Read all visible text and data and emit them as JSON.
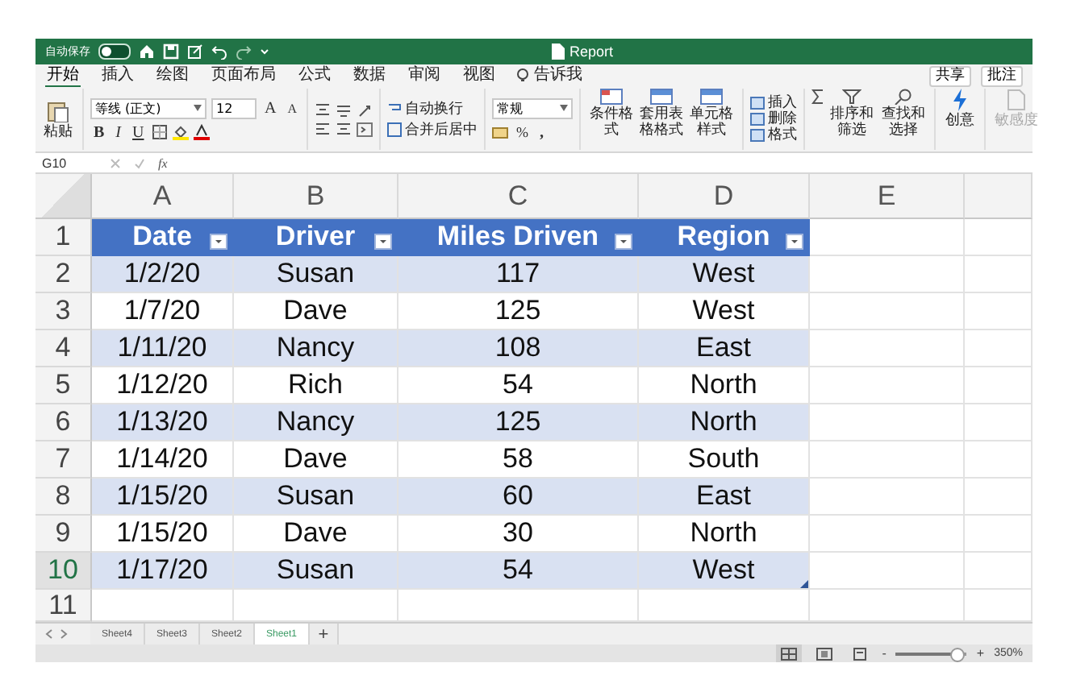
{
  "title_bar": {
    "autosave_label": "自动保存",
    "autosave_on": false,
    "title": "Report"
  },
  "menu": {
    "tabs": [
      {
        "label": "开始",
        "selected": true
      },
      {
        "label": "插入",
        "selected": false
      },
      {
        "label": "绘图",
        "selected": false
      },
      {
        "label": "页面布局",
        "selected": false
      },
      {
        "label": "公式",
        "selected": false
      },
      {
        "label": "数据",
        "selected": false
      },
      {
        "label": "审阅",
        "selected": false
      },
      {
        "label": "视图",
        "selected": false
      }
    ],
    "tell_me": "告诉我",
    "share": "共享",
    "comments": "批注"
  },
  "ribbon": {
    "paste": "粘贴",
    "font_name": "等线 (正文)",
    "font_size": "12",
    "font_grow": "A",
    "font_shrink": "A",
    "format_buttons": [
      "B",
      "I",
      "U"
    ],
    "wrap_text": "自动换行",
    "merge_center": "合并后居中",
    "number_format": "常规",
    "percent": "%",
    "comma": ",",
    "style_buttons": [
      "条件格式",
      "套用表格格式",
      "单元格样式"
    ],
    "cell_buttons": [
      "插入",
      "删除",
      "格式"
    ],
    "edit_buttons": [
      "排序和筛选",
      "查找和选择"
    ],
    "ideas": "创意",
    "sensitivity": {
      "label": "敏感度",
      "disabled": true
    }
  },
  "formula_bar": {
    "cell_ref": "G10",
    "fx": "fx"
  },
  "sheet": {
    "columns": [
      "A",
      "B",
      "C",
      "D",
      "E"
    ],
    "rows": [
      {
        "number": "1",
        "active": false,
        "kind": "header",
        "cells": [
          "Date",
          "Driver",
          "Miles Driven",
          "Region"
        ]
      },
      {
        "number": "2",
        "active": false,
        "kind": "data",
        "banded": true,
        "cells": [
          "1/2/20",
          "Susan",
          "117",
          "West"
        ]
      },
      {
        "number": "3",
        "active": false,
        "kind": "data",
        "banded": false,
        "cells": [
          "1/7/20",
          "Dave",
          "125",
          "West"
        ]
      },
      {
        "number": "4",
        "active": false,
        "kind": "data",
        "banded": true,
        "cells": [
          "1/11/20",
          "Nancy",
          "108",
          "East"
        ]
      },
      {
        "number": "5",
        "active": false,
        "kind": "data",
        "banded": false,
        "cells": [
          "1/12/20",
          "Rich",
          "54",
          "North"
        ]
      },
      {
        "number": "6",
        "active": false,
        "kind": "data",
        "banded": true,
        "cells": [
          "1/13/20",
          "Nancy",
          "125",
          "North"
        ]
      },
      {
        "number": "7",
        "active": false,
        "kind": "data",
        "banded": false,
        "cells": [
          "1/14/20",
          "Dave",
          "58",
          "South"
        ]
      },
      {
        "number": "8",
        "active": false,
        "kind": "data",
        "banded": true,
        "cells": [
          "1/15/20",
          "Susan",
          "60",
          "East"
        ]
      },
      {
        "number": "9",
        "active": false,
        "kind": "data",
        "banded": false,
        "cells": [
          "1/15/20",
          "Dave",
          "30",
          "North"
        ]
      },
      {
        "number": "10",
        "active": true,
        "kind": "data",
        "banded": true,
        "cells": [
          "1/17/20",
          "Susan",
          "54",
          "West"
        ]
      },
      {
        "number": "11",
        "active": false,
        "kind": "empty"
      }
    ]
  },
  "sheet_tabs": [
    {
      "label": "Sheet4",
      "selected": false
    },
    {
      "label": "Sheet3",
      "selected": false
    },
    {
      "label": "Sheet2",
      "selected": false
    },
    {
      "label": "Sheet1",
      "selected": true
    }
  ],
  "add_sheet": "+",
  "status_bar": {
    "views": [
      {
        "kind": "normal",
        "selected": true
      },
      {
        "kind": "page_layout",
        "selected": false
      },
      {
        "kind": "page_break",
        "selected": false
      }
    ],
    "zoom_minus": "-",
    "zoom_plus": "+",
    "zoom": {
      "level": 0.85
    },
    "zoom_reading": "350%"
  }
}
